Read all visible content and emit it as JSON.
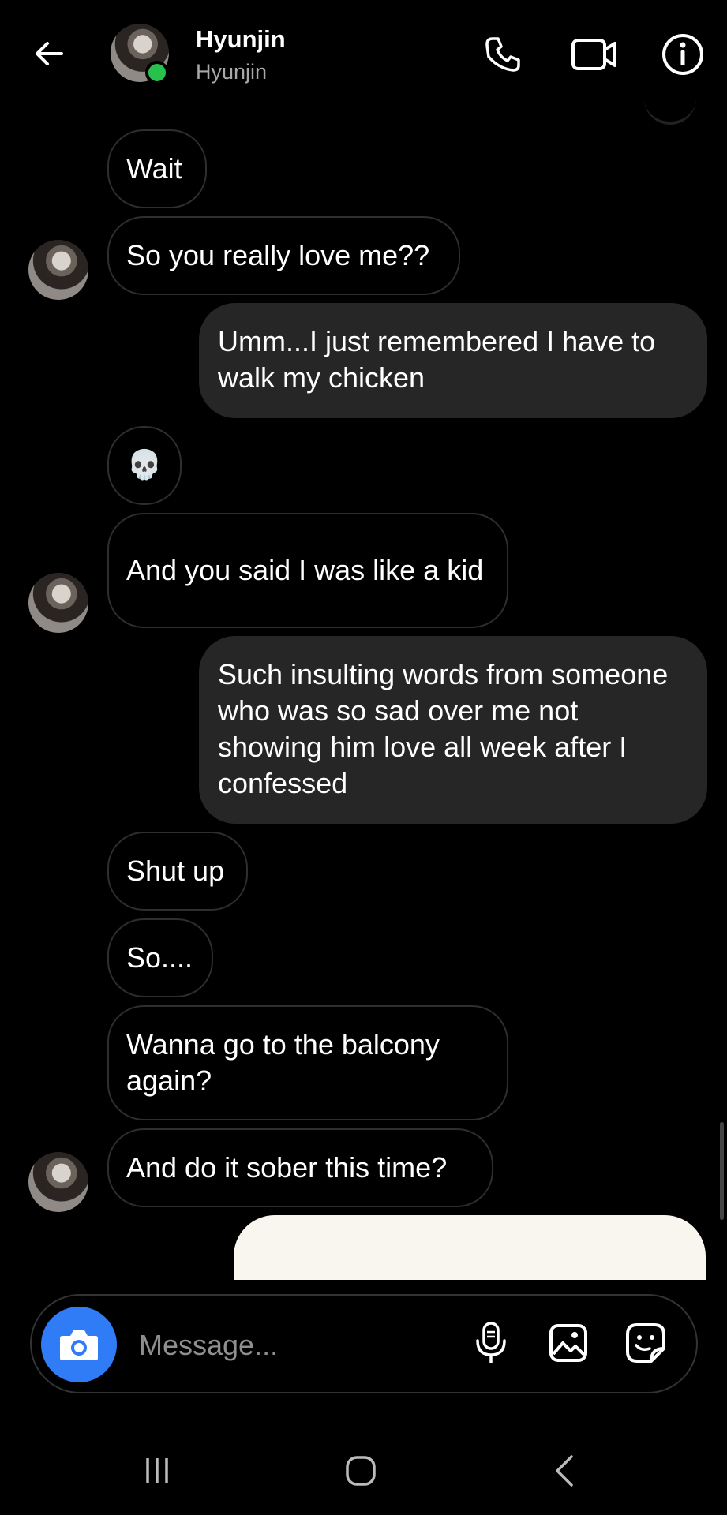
{
  "header": {
    "title": "Hyunjin",
    "subtitle": "Hyunjin",
    "status_color": "#26c24b",
    "icons": [
      "back-arrow-icon",
      "phone-icon",
      "video-camera-icon",
      "info-icon"
    ]
  },
  "messages": [
    {
      "side": "incoming",
      "text": "Wait"
    },
    {
      "side": "incoming",
      "text": "So you really love me??"
    },
    {
      "side": "outgoing",
      "text": "Umm...I just remembered I have to walk my chicken"
    },
    {
      "side": "incoming",
      "text": "💀"
    },
    {
      "side": "incoming",
      "text": "And you said I was like a kid"
    },
    {
      "side": "outgoing",
      "text": "Such insulting words from someone who was so sad over me not showing him love all week after I confessed"
    },
    {
      "side": "incoming",
      "text": "Shut up"
    },
    {
      "side": "incoming",
      "text": "So...."
    },
    {
      "side": "incoming",
      "text": "Wanna go to the balcony again?"
    },
    {
      "side": "incoming",
      "text": "And do it sober this time?"
    },
    {
      "side": "outgoing",
      "type": "image"
    }
  ],
  "composer": {
    "placeholder": "Message...",
    "accent": "#2f7cf6",
    "icons": [
      "camera-icon",
      "microphone-icon",
      "gallery-icon",
      "sticker-icon"
    ]
  },
  "navbar": {
    "icons": [
      "recent-apps-icon",
      "home-icon",
      "back-icon"
    ]
  }
}
